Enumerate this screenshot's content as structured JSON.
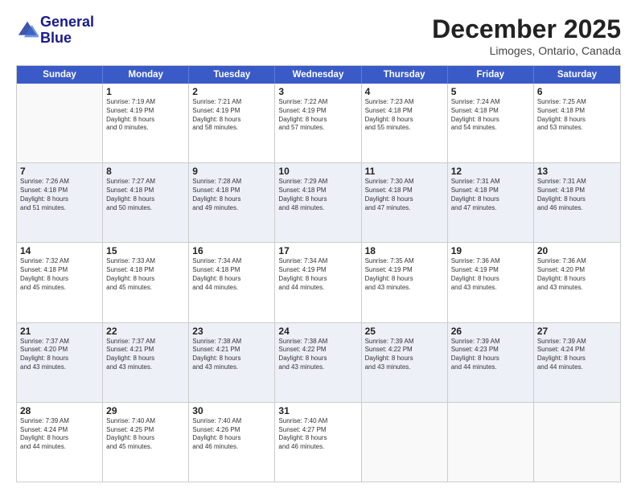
{
  "header": {
    "logo_line1": "General",
    "logo_line2": "Blue",
    "month": "December 2025",
    "location": "Limoges, Ontario, Canada"
  },
  "weekdays": [
    "Sunday",
    "Monday",
    "Tuesday",
    "Wednesday",
    "Thursday",
    "Friday",
    "Saturday"
  ],
  "rows": [
    [
      {
        "day": "",
        "lines": []
      },
      {
        "day": "1",
        "lines": [
          "Sunrise: 7:19 AM",
          "Sunset: 4:19 PM",
          "Daylight: 8 hours",
          "and 0 minutes."
        ]
      },
      {
        "day": "2",
        "lines": [
          "Sunrise: 7:21 AM",
          "Sunset: 4:19 PM",
          "Daylight: 8 hours",
          "and 58 minutes."
        ]
      },
      {
        "day": "3",
        "lines": [
          "Sunrise: 7:22 AM",
          "Sunset: 4:19 PM",
          "Daylight: 8 hours",
          "and 57 minutes."
        ]
      },
      {
        "day": "4",
        "lines": [
          "Sunrise: 7:23 AM",
          "Sunset: 4:18 PM",
          "Daylight: 8 hours",
          "and 55 minutes."
        ]
      },
      {
        "day": "5",
        "lines": [
          "Sunrise: 7:24 AM",
          "Sunset: 4:18 PM",
          "Daylight: 8 hours",
          "and 54 minutes."
        ]
      },
      {
        "day": "6",
        "lines": [
          "Sunrise: 7:25 AM",
          "Sunset: 4:18 PM",
          "Daylight: 8 hours",
          "and 53 minutes."
        ]
      }
    ],
    [
      {
        "day": "7",
        "lines": [
          "Sunrise: 7:26 AM",
          "Sunset: 4:18 PM",
          "Daylight: 8 hours",
          "and 51 minutes."
        ]
      },
      {
        "day": "8",
        "lines": [
          "Sunrise: 7:27 AM",
          "Sunset: 4:18 PM",
          "Daylight: 8 hours",
          "and 50 minutes."
        ]
      },
      {
        "day": "9",
        "lines": [
          "Sunrise: 7:28 AM",
          "Sunset: 4:18 PM",
          "Daylight: 8 hours",
          "and 49 minutes."
        ]
      },
      {
        "day": "10",
        "lines": [
          "Sunrise: 7:29 AM",
          "Sunset: 4:18 PM",
          "Daylight: 8 hours",
          "and 48 minutes."
        ]
      },
      {
        "day": "11",
        "lines": [
          "Sunrise: 7:30 AM",
          "Sunset: 4:18 PM",
          "Daylight: 8 hours",
          "and 47 minutes."
        ]
      },
      {
        "day": "12",
        "lines": [
          "Sunrise: 7:31 AM",
          "Sunset: 4:18 PM",
          "Daylight: 8 hours",
          "and 47 minutes."
        ]
      },
      {
        "day": "13",
        "lines": [
          "Sunrise: 7:31 AM",
          "Sunset: 4:18 PM",
          "Daylight: 8 hours",
          "and 46 minutes."
        ]
      }
    ],
    [
      {
        "day": "14",
        "lines": [
          "Sunrise: 7:32 AM",
          "Sunset: 4:18 PM",
          "Daylight: 8 hours",
          "and 45 minutes."
        ]
      },
      {
        "day": "15",
        "lines": [
          "Sunrise: 7:33 AM",
          "Sunset: 4:18 PM",
          "Daylight: 8 hours",
          "and 45 minutes."
        ]
      },
      {
        "day": "16",
        "lines": [
          "Sunrise: 7:34 AM",
          "Sunset: 4:18 PM",
          "Daylight: 8 hours",
          "and 44 minutes."
        ]
      },
      {
        "day": "17",
        "lines": [
          "Sunrise: 7:34 AM",
          "Sunset: 4:19 PM",
          "Daylight: 8 hours",
          "and 44 minutes."
        ]
      },
      {
        "day": "18",
        "lines": [
          "Sunrise: 7:35 AM",
          "Sunset: 4:19 PM",
          "Daylight: 8 hours",
          "and 43 minutes."
        ]
      },
      {
        "day": "19",
        "lines": [
          "Sunrise: 7:36 AM",
          "Sunset: 4:19 PM",
          "Daylight: 8 hours",
          "and 43 minutes."
        ]
      },
      {
        "day": "20",
        "lines": [
          "Sunrise: 7:36 AM",
          "Sunset: 4:20 PM",
          "Daylight: 8 hours",
          "and 43 minutes."
        ]
      }
    ],
    [
      {
        "day": "21",
        "lines": [
          "Sunrise: 7:37 AM",
          "Sunset: 4:20 PM",
          "Daylight: 8 hours",
          "and 43 minutes."
        ]
      },
      {
        "day": "22",
        "lines": [
          "Sunrise: 7:37 AM",
          "Sunset: 4:21 PM",
          "Daylight: 8 hours",
          "and 43 minutes."
        ]
      },
      {
        "day": "23",
        "lines": [
          "Sunrise: 7:38 AM",
          "Sunset: 4:21 PM",
          "Daylight: 8 hours",
          "and 43 minutes."
        ]
      },
      {
        "day": "24",
        "lines": [
          "Sunrise: 7:38 AM",
          "Sunset: 4:22 PM",
          "Daylight: 8 hours",
          "and 43 minutes."
        ]
      },
      {
        "day": "25",
        "lines": [
          "Sunrise: 7:39 AM",
          "Sunset: 4:22 PM",
          "Daylight: 8 hours",
          "and 43 minutes."
        ]
      },
      {
        "day": "26",
        "lines": [
          "Sunrise: 7:39 AM",
          "Sunset: 4:23 PM",
          "Daylight: 8 hours",
          "and 44 minutes."
        ]
      },
      {
        "day": "27",
        "lines": [
          "Sunrise: 7:39 AM",
          "Sunset: 4:24 PM",
          "Daylight: 8 hours",
          "and 44 minutes."
        ]
      }
    ],
    [
      {
        "day": "28",
        "lines": [
          "Sunrise: 7:39 AM",
          "Sunset: 4:24 PM",
          "Daylight: 8 hours",
          "and 44 minutes."
        ]
      },
      {
        "day": "29",
        "lines": [
          "Sunrise: 7:40 AM",
          "Sunset: 4:25 PM",
          "Daylight: 8 hours",
          "and 45 minutes."
        ]
      },
      {
        "day": "30",
        "lines": [
          "Sunrise: 7:40 AM",
          "Sunset: 4:26 PM",
          "Daylight: 8 hours",
          "and 46 minutes."
        ]
      },
      {
        "day": "31",
        "lines": [
          "Sunrise: 7:40 AM",
          "Sunset: 4:27 PM",
          "Daylight: 8 hours",
          "and 46 minutes."
        ]
      },
      {
        "day": "",
        "lines": []
      },
      {
        "day": "",
        "lines": []
      },
      {
        "day": "",
        "lines": []
      }
    ]
  ]
}
